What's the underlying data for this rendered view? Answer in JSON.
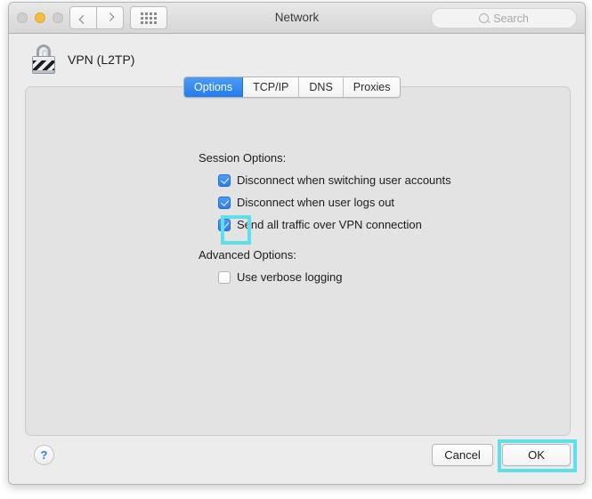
{
  "window": {
    "title": "Network",
    "traffic_lights": [
      {
        "name": "close",
        "color": "#cfcfcf",
        "state": "inactive"
      },
      {
        "name": "minimize",
        "color": "#f5bc40",
        "state": "active"
      },
      {
        "name": "zoom",
        "color": "#cfcfcf",
        "state": "inactive"
      }
    ],
    "nav": {
      "back_icon": "chevron-left-icon",
      "forward_icon": "chevron-right-icon"
    },
    "show_all_icon": "grid-dots-icon"
  },
  "search": {
    "placeholder": "Search",
    "value": "",
    "icon": "search-icon"
  },
  "service": {
    "name": "VPN (L2TP)",
    "icon": "padlock-icon"
  },
  "tabs": [
    {
      "label": "Options",
      "active": true
    },
    {
      "label": "TCP/IP",
      "active": false
    },
    {
      "label": "DNS",
      "active": false
    },
    {
      "label": "Proxies",
      "active": false
    }
  ],
  "sections": [
    {
      "label": "Session Options:",
      "checkboxes": [
        {
          "label": "Disconnect when switching user accounts",
          "checked": true
        },
        {
          "label": "Disconnect when user logs out",
          "checked": true
        },
        {
          "label": "Send all traffic over VPN connection",
          "checked": true,
          "highlighted": true
        }
      ]
    },
    {
      "label": "Advanced Options:",
      "checkboxes": [
        {
          "label": "Use verbose logging",
          "checked": false
        }
      ]
    }
  ],
  "footer": {
    "help_label": "?",
    "cancel_label": "Cancel",
    "ok_label": "OK",
    "ok_highlighted": true
  },
  "colors": {
    "accent_blue": "#2b7ded",
    "highlight_cyan": "#5fdfe8",
    "window_chrome": "#ececec",
    "panel": "#e3e3e3"
  }
}
